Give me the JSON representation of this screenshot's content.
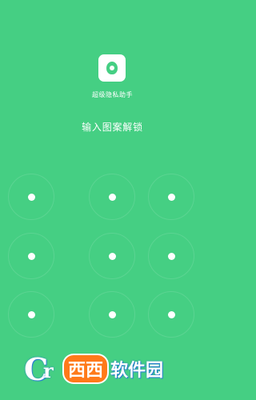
{
  "app": {
    "icon": "shield-icon",
    "name": "超级隐私助手"
  },
  "lock_screen": {
    "prompt": "输入图案解锁",
    "dot_count": 9
  },
  "watermark": {
    "logo_text_c": "C",
    "logo_text_r": "r",
    "brand": "西西",
    "site": "软件园"
  },
  "colors": {
    "background": "#45cf83",
    "dot": "#ffffff",
    "watermark_accent": "#ff7a1a"
  }
}
